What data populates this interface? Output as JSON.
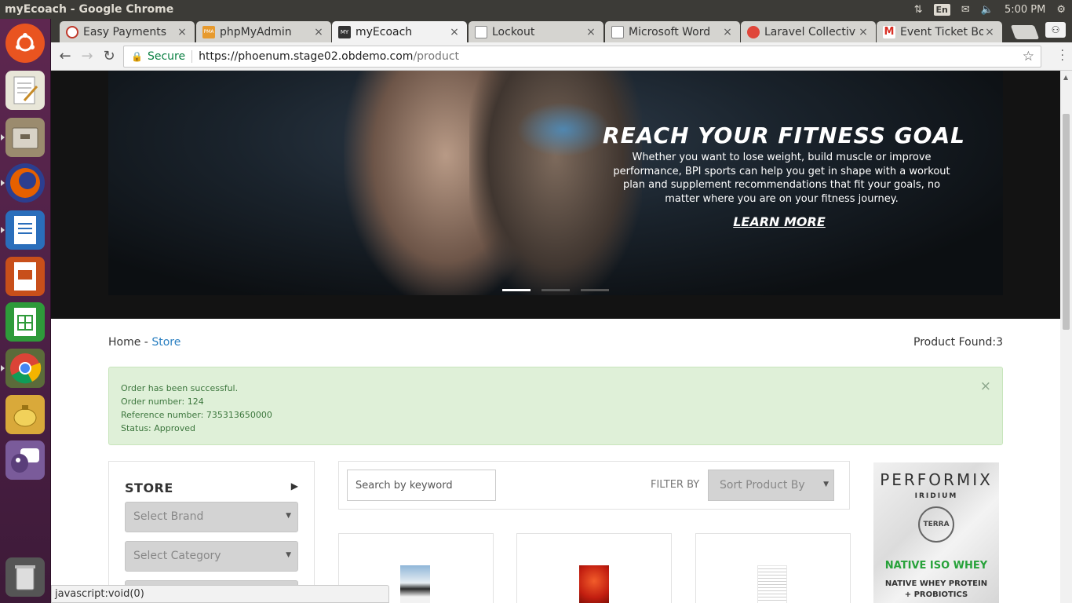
{
  "os": {
    "window_title": "myEcoach - Google Chrome",
    "keyboard": "En",
    "clock": "5:00 PM"
  },
  "launcher": {
    "apps": [
      {
        "icon": "ubuntu-dash-icon",
        "color": "#e95420"
      },
      {
        "icon": "text-editor-icon",
        "color": "#e8e6d8"
      },
      {
        "icon": "file-manager-icon",
        "color": "#9b8b6e"
      },
      {
        "icon": "firefox-icon",
        "color": "#e66000"
      },
      {
        "icon": "libreoffice-writer-icon",
        "color": "#2a6ebb"
      },
      {
        "icon": "libreoffice-impress-icon",
        "color": "#c84f1a"
      },
      {
        "icon": "libreoffice-calc-icon",
        "color": "#2e9a3a"
      },
      {
        "icon": "chrome-icon",
        "color": "#4285f4"
      },
      {
        "icon": "teapot-icon",
        "color": "#e0b62c"
      },
      {
        "icon": "pidgin-icon",
        "color": "#7a5b9a"
      },
      {
        "icon": "trash-icon",
        "color": "#777777"
      }
    ]
  },
  "browser": {
    "tabs": [
      {
        "label": "Easy Payments",
        "icon": "easy-payments-favicon",
        "color": "#c0392b"
      },
      {
        "label": "phpMyAdmin",
        "icon": "phpmyadmin-favicon",
        "color": "#e79a2d",
        "badge": "PMA"
      },
      {
        "label": "myEcoach",
        "icon": "myecoach-favicon",
        "color": "#333333",
        "badge": "MY"
      },
      {
        "label": "Lockout",
        "icon": "document-favicon",
        "color": "#999999"
      },
      {
        "label": "Microsoft Word",
        "icon": "document-favicon",
        "color": "#999999"
      },
      {
        "label": "Laravel Collectiv",
        "icon": "laravel-favicon",
        "color": "#e0463a"
      },
      {
        "label": "Event Ticket Boo",
        "icon": "gmail-favicon",
        "color": "#d93025",
        "badge": "M"
      }
    ],
    "close_glyph": "×",
    "profile_glyph": "⚇",
    "address": {
      "secure_label": "Secure",
      "url_main": "https://phoenum.stage02.obdemo.com",
      "url_path": "/product"
    },
    "status_text": "javascript:void(0)"
  },
  "banner": {
    "title": "REACH YOUR FITNESS GOAL",
    "text": "Whether you want to lose weight, build muscle or improve performance, BPI sports can help you get in shape with a workout plan and supplement recommendations that fit your goals, no matter where you are on your fitness journey.",
    "cta": "LEARN MORE",
    "slides": 3,
    "active_slide": 1
  },
  "breadcrumb": {
    "home": "Home",
    "separator": "-",
    "current": "Store"
  },
  "product_found": "Product Found:3",
  "alert": {
    "lines": [
      "Order has been successful.",
      "Order number: 124",
      "Reference number: 735313650000",
      "Status: Approved"
    ],
    "close": "×"
  },
  "sidebar": {
    "title": "STORE",
    "brand_placeholder": "Select Brand",
    "category_placeholder": "Select Category"
  },
  "filter": {
    "search_placeholder": "Search by keyword",
    "label": "FILTER BY",
    "sort_placeholder": "Sort Product By"
  },
  "ad": {
    "brand": "PERFORMIX",
    "sub": "IRIDIUM",
    "terra": "TERRA",
    "headline": "NATIVE ISO WHEY",
    "line1": "NATIVE WHEY PROTEIN",
    "line2": "+ PROBIOTICS"
  }
}
